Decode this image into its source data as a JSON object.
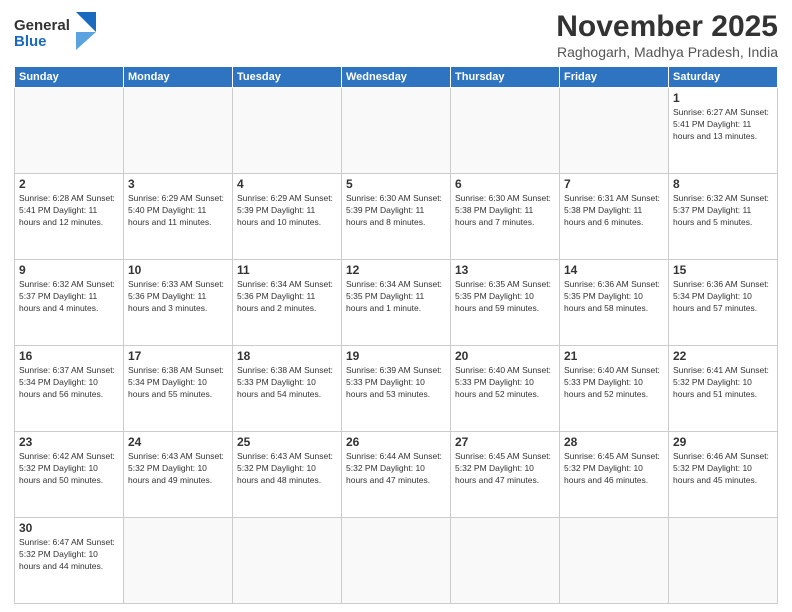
{
  "logo": {
    "text_general": "General",
    "text_blue": "Blue"
  },
  "header": {
    "month": "November 2025",
    "location": "Raghogarh, Madhya Pradesh, India"
  },
  "weekdays": [
    "Sunday",
    "Monday",
    "Tuesday",
    "Wednesday",
    "Thursday",
    "Friday",
    "Saturday"
  ],
  "weeks": [
    [
      {
        "day": "",
        "info": ""
      },
      {
        "day": "",
        "info": ""
      },
      {
        "day": "",
        "info": ""
      },
      {
        "day": "",
        "info": ""
      },
      {
        "day": "",
        "info": ""
      },
      {
        "day": "",
        "info": ""
      },
      {
        "day": "1",
        "info": "Sunrise: 6:27 AM\nSunset: 5:41 PM\nDaylight: 11 hours and 13 minutes."
      }
    ],
    [
      {
        "day": "2",
        "info": "Sunrise: 6:28 AM\nSunset: 5:41 PM\nDaylight: 11 hours and 12 minutes."
      },
      {
        "day": "3",
        "info": "Sunrise: 6:29 AM\nSunset: 5:40 PM\nDaylight: 11 hours and 11 minutes."
      },
      {
        "day": "4",
        "info": "Sunrise: 6:29 AM\nSunset: 5:39 PM\nDaylight: 11 hours and 10 minutes."
      },
      {
        "day": "5",
        "info": "Sunrise: 6:30 AM\nSunset: 5:39 PM\nDaylight: 11 hours and 8 minutes."
      },
      {
        "day": "6",
        "info": "Sunrise: 6:30 AM\nSunset: 5:38 PM\nDaylight: 11 hours and 7 minutes."
      },
      {
        "day": "7",
        "info": "Sunrise: 6:31 AM\nSunset: 5:38 PM\nDaylight: 11 hours and 6 minutes."
      },
      {
        "day": "8",
        "info": "Sunrise: 6:32 AM\nSunset: 5:37 PM\nDaylight: 11 hours and 5 minutes."
      }
    ],
    [
      {
        "day": "9",
        "info": "Sunrise: 6:32 AM\nSunset: 5:37 PM\nDaylight: 11 hours and 4 minutes."
      },
      {
        "day": "10",
        "info": "Sunrise: 6:33 AM\nSunset: 5:36 PM\nDaylight: 11 hours and 3 minutes."
      },
      {
        "day": "11",
        "info": "Sunrise: 6:34 AM\nSunset: 5:36 PM\nDaylight: 11 hours and 2 minutes."
      },
      {
        "day": "12",
        "info": "Sunrise: 6:34 AM\nSunset: 5:35 PM\nDaylight: 11 hours and 1 minute."
      },
      {
        "day": "13",
        "info": "Sunrise: 6:35 AM\nSunset: 5:35 PM\nDaylight: 10 hours and 59 minutes."
      },
      {
        "day": "14",
        "info": "Sunrise: 6:36 AM\nSunset: 5:35 PM\nDaylight: 10 hours and 58 minutes."
      },
      {
        "day": "15",
        "info": "Sunrise: 6:36 AM\nSunset: 5:34 PM\nDaylight: 10 hours and 57 minutes."
      }
    ],
    [
      {
        "day": "16",
        "info": "Sunrise: 6:37 AM\nSunset: 5:34 PM\nDaylight: 10 hours and 56 minutes."
      },
      {
        "day": "17",
        "info": "Sunrise: 6:38 AM\nSunset: 5:34 PM\nDaylight: 10 hours and 55 minutes."
      },
      {
        "day": "18",
        "info": "Sunrise: 6:38 AM\nSunset: 5:33 PM\nDaylight: 10 hours and 54 minutes."
      },
      {
        "day": "19",
        "info": "Sunrise: 6:39 AM\nSunset: 5:33 PM\nDaylight: 10 hours and 53 minutes."
      },
      {
        "day": "20",
        "info": "Sunrise: 6:40 AM\nSunset: 5:33 PM\nDaylight: 10 hours and 52 minutes."
      },
      {
        "day": "21",
        "info": "Sunrise: 6:40 AM\nSunset: 5:33 PM\nDaylight: 10 hours and 52 minutes."
      },
      {
        "day": "22",
        "info": "Sunrise: 6:41 AM\nSunset: 5:32 PM\nDaylight: 10 hours and 51 minutes."
      }
    ],
    [
      {
        "day": "23",
        "info": "Sunrise: 6:42 AM\nSunset: 5:32 PM\nDaylight: 10 hours and 50 minutes."
      },
      {
        "day": "24",
        "info": "Sunrise: 6:43 AM\nSunset: 5:32 PM\nDaylight: 10 hours and 49 minutes."
      },
      {
        "day": "25",
        "info": "Sunrise: 6:43 AM\nSunset: 5:32 PM\nDaylight: 10 hours and 48 minutes."
      },
      {
        "day": "26",
        "info": "Sunrise: 6:44 AM\nSunset: 5:32 PM\nDaylight: 10 hours and 47 minutes."
      },
      {
        "day": "27",
        "info": "Sunrise: 6:45 AM\nSunset: 5:32 PM\nDaylight: 10 hours and 47 minutes."
      },
      {
        "day": "28",
        "info": "Sunrise: 6:45 AM\nSunset: 5:32 PM\nDaylight: 10 hours and 46 minutes."
      },
      {
        "day": "29",
        "info": "Sunrise: 6:46 AM\nSunset: 5:32 PM\nDaylight: 10 hours and 45 minutes."
      }
    ],
    [
      {
        "day": "30",
        "info": "Sunrise: 6:47 AM\nSunset: 5:32 PM\nDaylight: 10 hours and 44 minutes."
      },
      {
        "day": "",
        "info": ""
      },
      {
        "day": "",
        "info": ""
      },
      {
        "day": "",
        "info": ""
      },
      {
        "day": "",
        "info": ""
      },
      {
        "day": "",
        "info": ""
      },
      {
        "day": "",
        "info": ""
      }
    ]
  ]
}
